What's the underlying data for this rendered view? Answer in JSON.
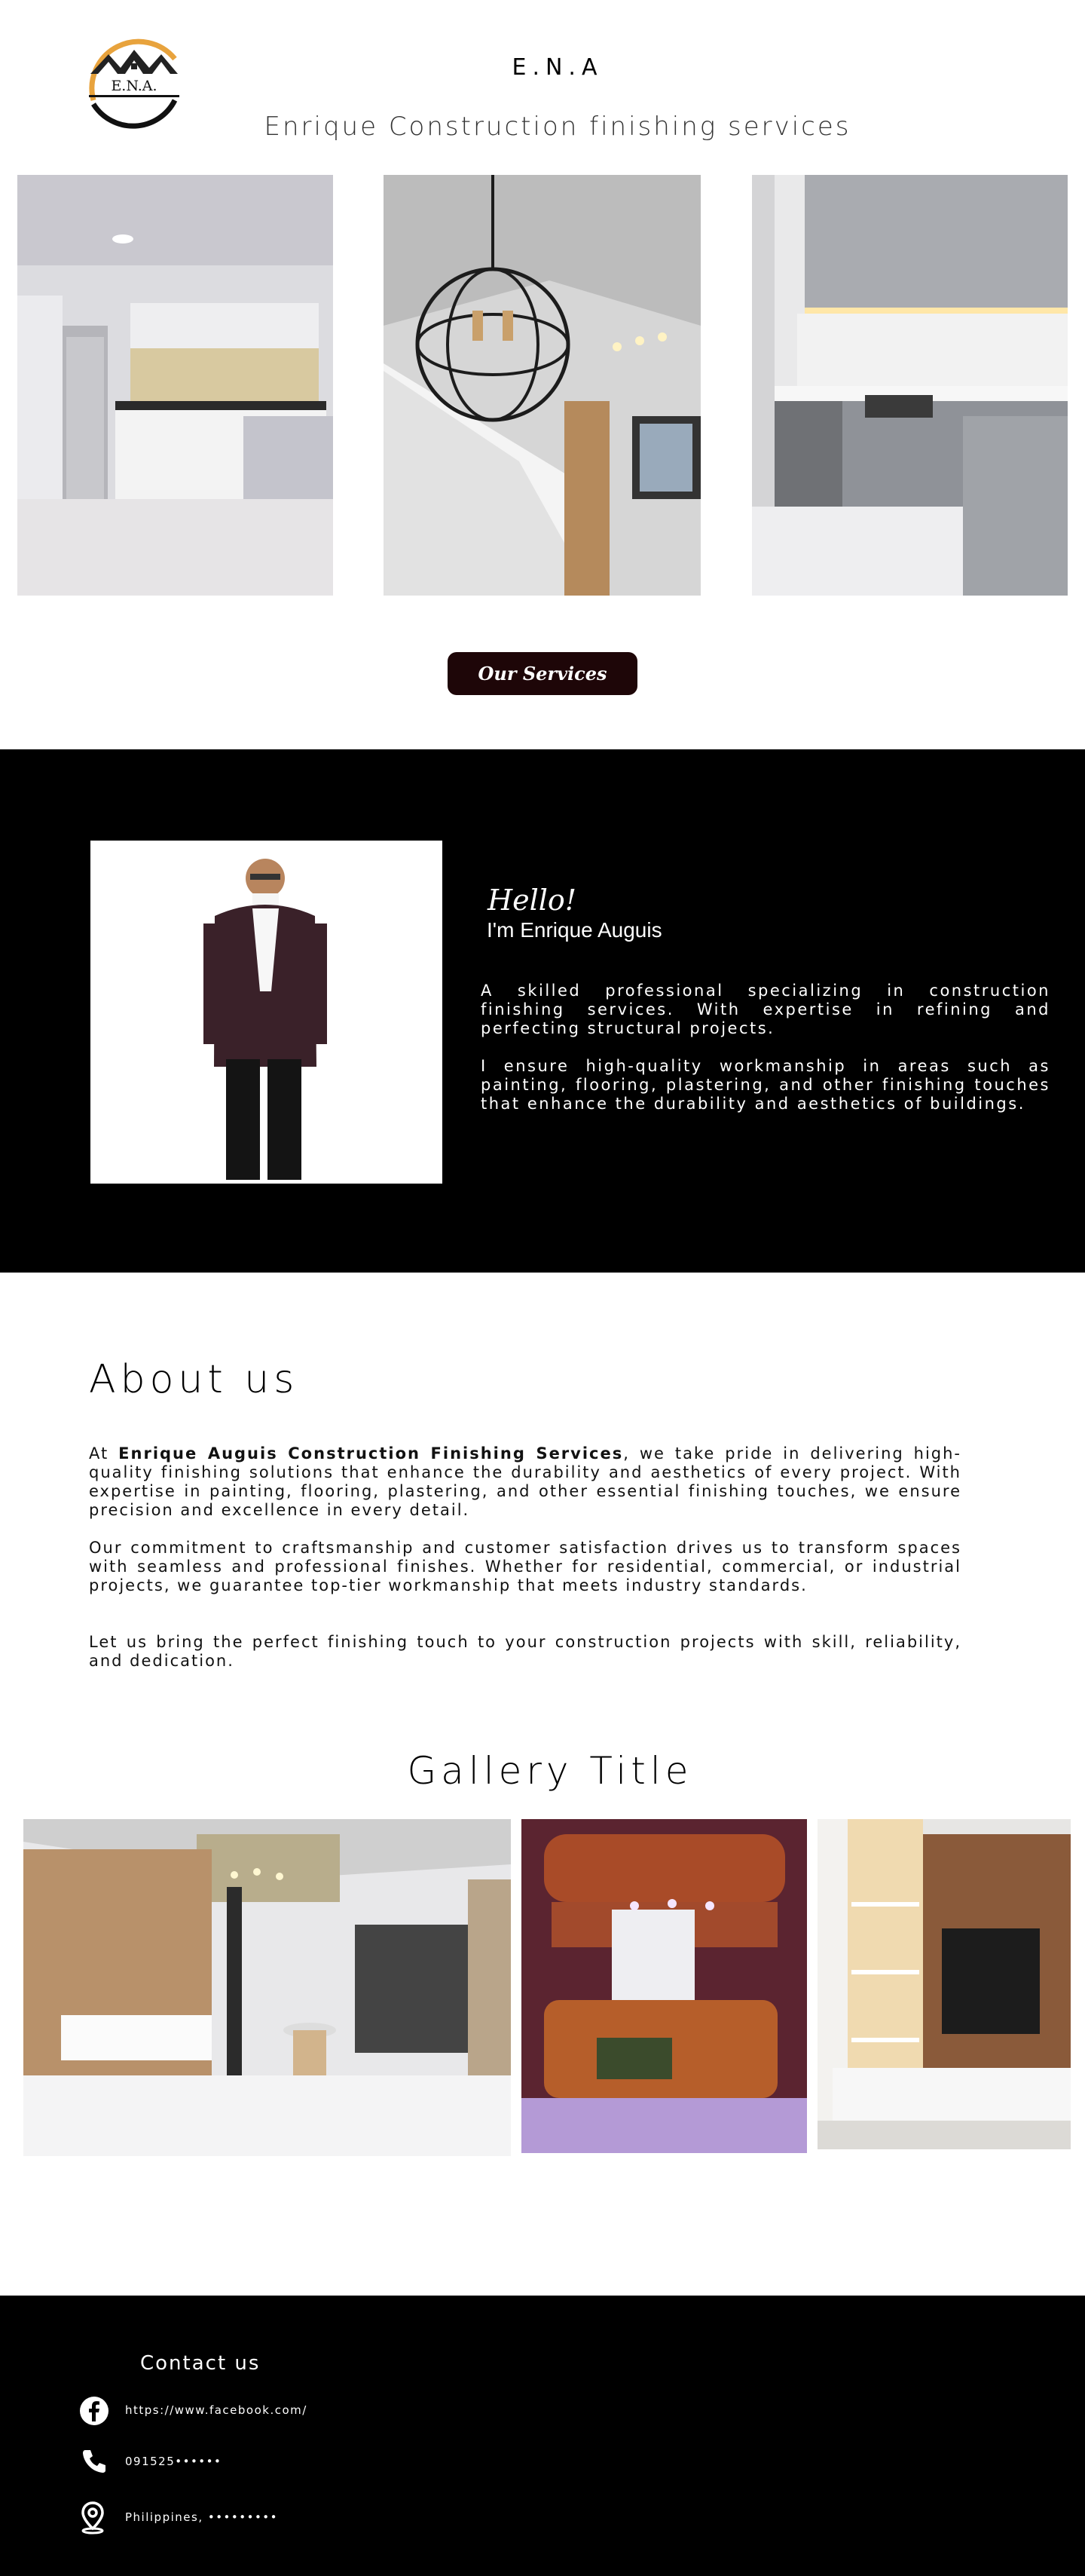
{
  "header": {
    "logo_text": "E.N.A.",
    "brand": "E.N.A",
    "tagline": "Enrique Construction finishing services"
  },
  "hero": {
    "services_button": "Our Services"
  },
  "intro": {
    "greeting": "Hello!",
    "name": "I'm Enrique Auguis",
    "paragraph_1": "A skilled professional specializing in construction finishing services. With expertise in refining and perfecting structural projects.",
    "paragraph_2": "I ensure high-quality workmanship in areas such as painting, flooring, plastering, and other finishing touches that enhance the durability and aesthetics of buildings."
  },
  "about": {
    "title": "About us",
    "p1_prefix": "At ",
    "p1_bold": "Enrique Auguis Construction Finishing Services",
    "p1_rest": ", we take pride in delivering high-quality finishing solutions that enhance the durability and aesthetics of every project. With expertise in painting, flooring, plastering, and other essential finishing touches, we ensure precision and excellence in every detail.",
    "paragraph_2": "Our commitment to craftsmanship and customer satisfaction drives us to transform spaces with seamless and professional finishes. Whether for residential, commercial, or industrial projects, we guarantee top-tier workmanship that meets industry standards.",
    "paragraph_3": "Let us bring the perfect finishing touch to your construction projects with skill, reliability, and dedication."
  },
  "gallery": {
    "title": "Gallery Title"
  },
  "footer": {
    "contact_title": "Contact us",
    "facebook": "https://www.facebook.com/",
    "phone": "091525••••••",
    "location": "Philippines, •••••••••"
  },
  "colors": {
    "button_bg": "#1e0608",
    "band_bg": "#000000",
    "logo_gold": "#e8a33d"
  }
}
